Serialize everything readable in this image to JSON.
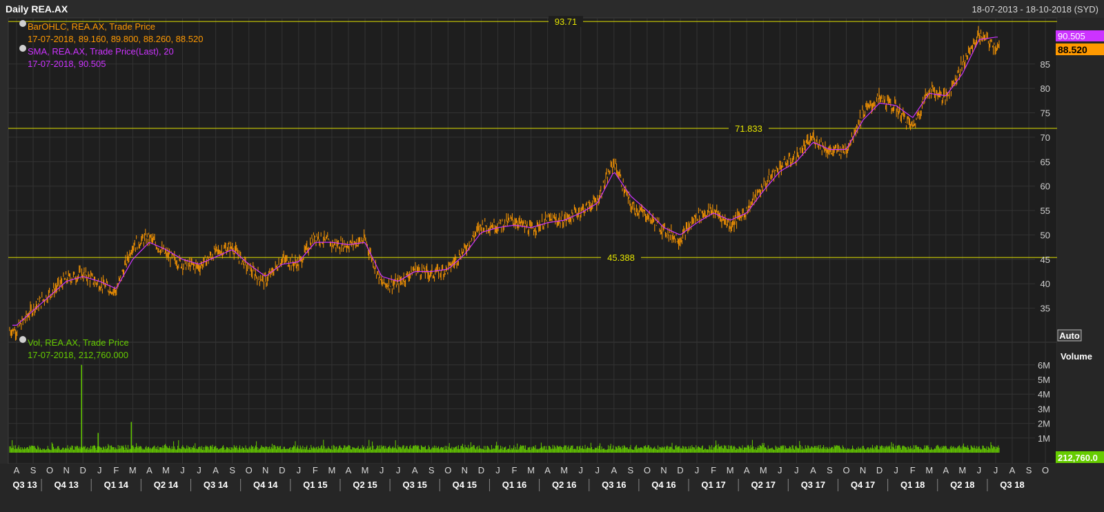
{
  "header": {
    "title": "Daily REA.AX",
    "date_range": "18-07-2013 - 18-10-2018 (SYD)"
  },
  "legend": {
    "ohlc_title": "BarOHLC, REA.AX, Trade Price",
    "ohlc_values": "17-07-2018, 89.160, 89.800, 88.260, 88.520",
    "sma_title": "SMA, REA.AX, Trade Price(Last),  20",
    "sma_values": "17-07-2018, 90.505",
    "vol_title": "Vol, REA.AX, Trade Price",
    "vol_values": "17-07-2018, 212,760.000"
  },
  "hlines": [
    {
      "value": 93.71,
      "label": "93.71"
    },
    {
      "value": 71.833,
      "label": "71.833"
    },
    {
      "value": 45.388,
      "label": "45.388"
    }
  ],
  "price_tags": {
    "sma": "90.505",
    "last": "88.520",
    "volume": "212,760.0"
  },
  "buttons": {
    "price_auto": "Auto",
    "volume_auto": "Auto"
  },
  "colors": {
    "ohlc": "#ff9900",
    "sma": "#cc33ff",
    "volume": "#66cc00",
    "hline": "#e6e600",
    "sma_tag": "#cc33ff",
    "last_tag": "#ff9900",
    "vol_tag": "#66cc00"
  },
  "chart_data": {
    "type": "line",
    "title": "Daily REA.AX",
    "price_axis": {
      "ticks": [
        35,
        40,
        45,
        50,
        55,
        60,
        65,
        70,
        75,
        80,
        85
      ],
      "range": [
        30,
        95
      ]
    },
    "volume_axis": {
      "label": "Volume",
      "ticks": [
        "1M",
        "2M",
        "3M",
        "4M",
        "5M",
        "6M"
      ],
      "range_millions": [
        0,
        6.5
      ]
    },
    "months": [
      "A",
      "S",
      "O",
      "N",
      "D",
      "J",
      "F",
      "M",
      "A",
      "M",
      "J",
      "J",
      "A",
      "S",
      "O",
      "N",
      "D",
      "J",
      "F",
      "M",
      "A",
      "M",
      "J",
      "J",
      "A",
      "S",
      "O",
      "N",
      "D",
      "J",
      "F",
      "M",
      "A",
      "M",
      "J",
      "J",
      "A",
      "S",
      "O",
      "N",
      "D",
      "J",
      "F",
      "M",
      "A",
      "M",
      "J",
      "J",
      "A",
      "S",
      "O",
      "N",
      "D",
      "J",
      "F",
      "M",
      "A",
      "M",
      "J",
      "J",
      "A",
      "S",
      "O"
    ],
    "quarters": [
      "Q3 13",
      "Q4 13",
      "Q1 14",
      "Q2 14",
      "Q3 14",
      "Q4 14",
      "Q1 15",
      "Q2 15",
      "Q3 15",
      "Q4 15",
      "Q1 16",
      "Q2 16",
      "Q3 16",
      "Q4 16",
      "Q1 17",
      "Q2 17",
      "Q3 17",
      "Q4 17",
      "Q1 18",
      "Q2 18",
      "Q3 18"
    ],
    "series": [
      {
        "name": "BarOHLC, REA.AX, Trade Price",
        "month_index": [
          0,
          1,
          2,
          3,
          4,
          5,
          6,
          7,
          8,
          9,
          10,
          11,
          12,
          13,
          14,
          15,
          16,
          17,
          18,
          19,
          20,
          21,
          22,
          23,
          24,
          25,
          26,
          27,
          28,
          29,
          30,
          31,
          32,
          33,
          34,
          35,
          36,
          37,
          38,
          39,
          40,
          41,
          42,
          43,
          44,
          45,
          46,
          47,
          48,
          49,
          50,
          51,
          52,
          53,
          54,
          55,
          56,
          57,
          58,
          59
        ],
        "values": [
          30.5,
          35,
          38,
          41,
          42,
          40,
          38.5,
          48,
          49.5,
          46,
          44,
          43.5,
          46.5,
          47.5,
          43,
          40.5,
          45,
          44,
          50,
          48,
          48,
          49,
          40,
          40,
          43,
          42,
          43,
          47,
          52,
          52,
          53,
          51,
          53,
          53,
          55,
          57,
          65,
          56,
          54,
          51,
          49,
          54,
          55,
          52,
          55,
          60,
          64,
          66,
          70,
          67,
          67.5,
          75,
          78,
          76,
          72,
          80,
          78,
          85,
          91,
          88.5
        ]
      },
      {
        "name": "SMA, REA.AX, Trade Price(Last),  20",
        "month_index": [
          0,
          1,
          2,
          3,
          4,
          5,
          6,
          7,
          8,
          9,
          10,
          11,
          12,
          13,
          14,
          15,
          16,
          17,
          18,
          19,
          20,
          21,
          22,
          23,
          24,
          25,
          26,
          27,
          28,
          29,
          30,
          31,
          32,
          33,
          34,
          35,
          36,
          37,
          38,
          39,
          40,
          41,
          42,
          43,
          44,
          45,
          46,
          47,
          48,
          49,
          50,
          51,
          52,
          53,
          54,
          55,
          56,
          57,
          58,
          59
        ],
        "values": [
          31.5,
          34.5,
          37.5,
          40.5,
          41.5,
          40.5,
          39,
          45,
          48.5,
          47,
          45,
          44,
          45.5,
          47,
          44,
          41.5,
          44,
          44.5,
          48.5,
          48.5,
          48,
          48.5,
          41.5,
          40.5,
          42.5,
          42.5,
          43,
          46,
          50.5,
          51.5,
          52,
          51.5,
          52.5,
          53,
          54.5,
          56.5,
          63,
          58,
          55,
          51.5,
          50,
          52.5,
          54.5,
          53,
          54.5,
          59,
          63,
          65,
          69,
          67.5,
          67.5,
          73.5,
          77,
          76.5,
          74,
          79,
          78.5,
          83,
          90,
          90.5
        ]
      }
    ],
    "volume_spikes_millions": [
      {
        "month": "D",
        "value": 6.0
      },
      {
        "month": "J",
        "value": 1.35
      },
      {
        "month": "M",
        "value": 2.1
      }
    ],
    "last": {
      "date": "17-07-2018",
      "open": 89.16,
      "high": 89.8,
      "low": 88.26,
      "close": 88.52,
      "sma20": 90.505,
      "volume": 212760
    }
  }
}
